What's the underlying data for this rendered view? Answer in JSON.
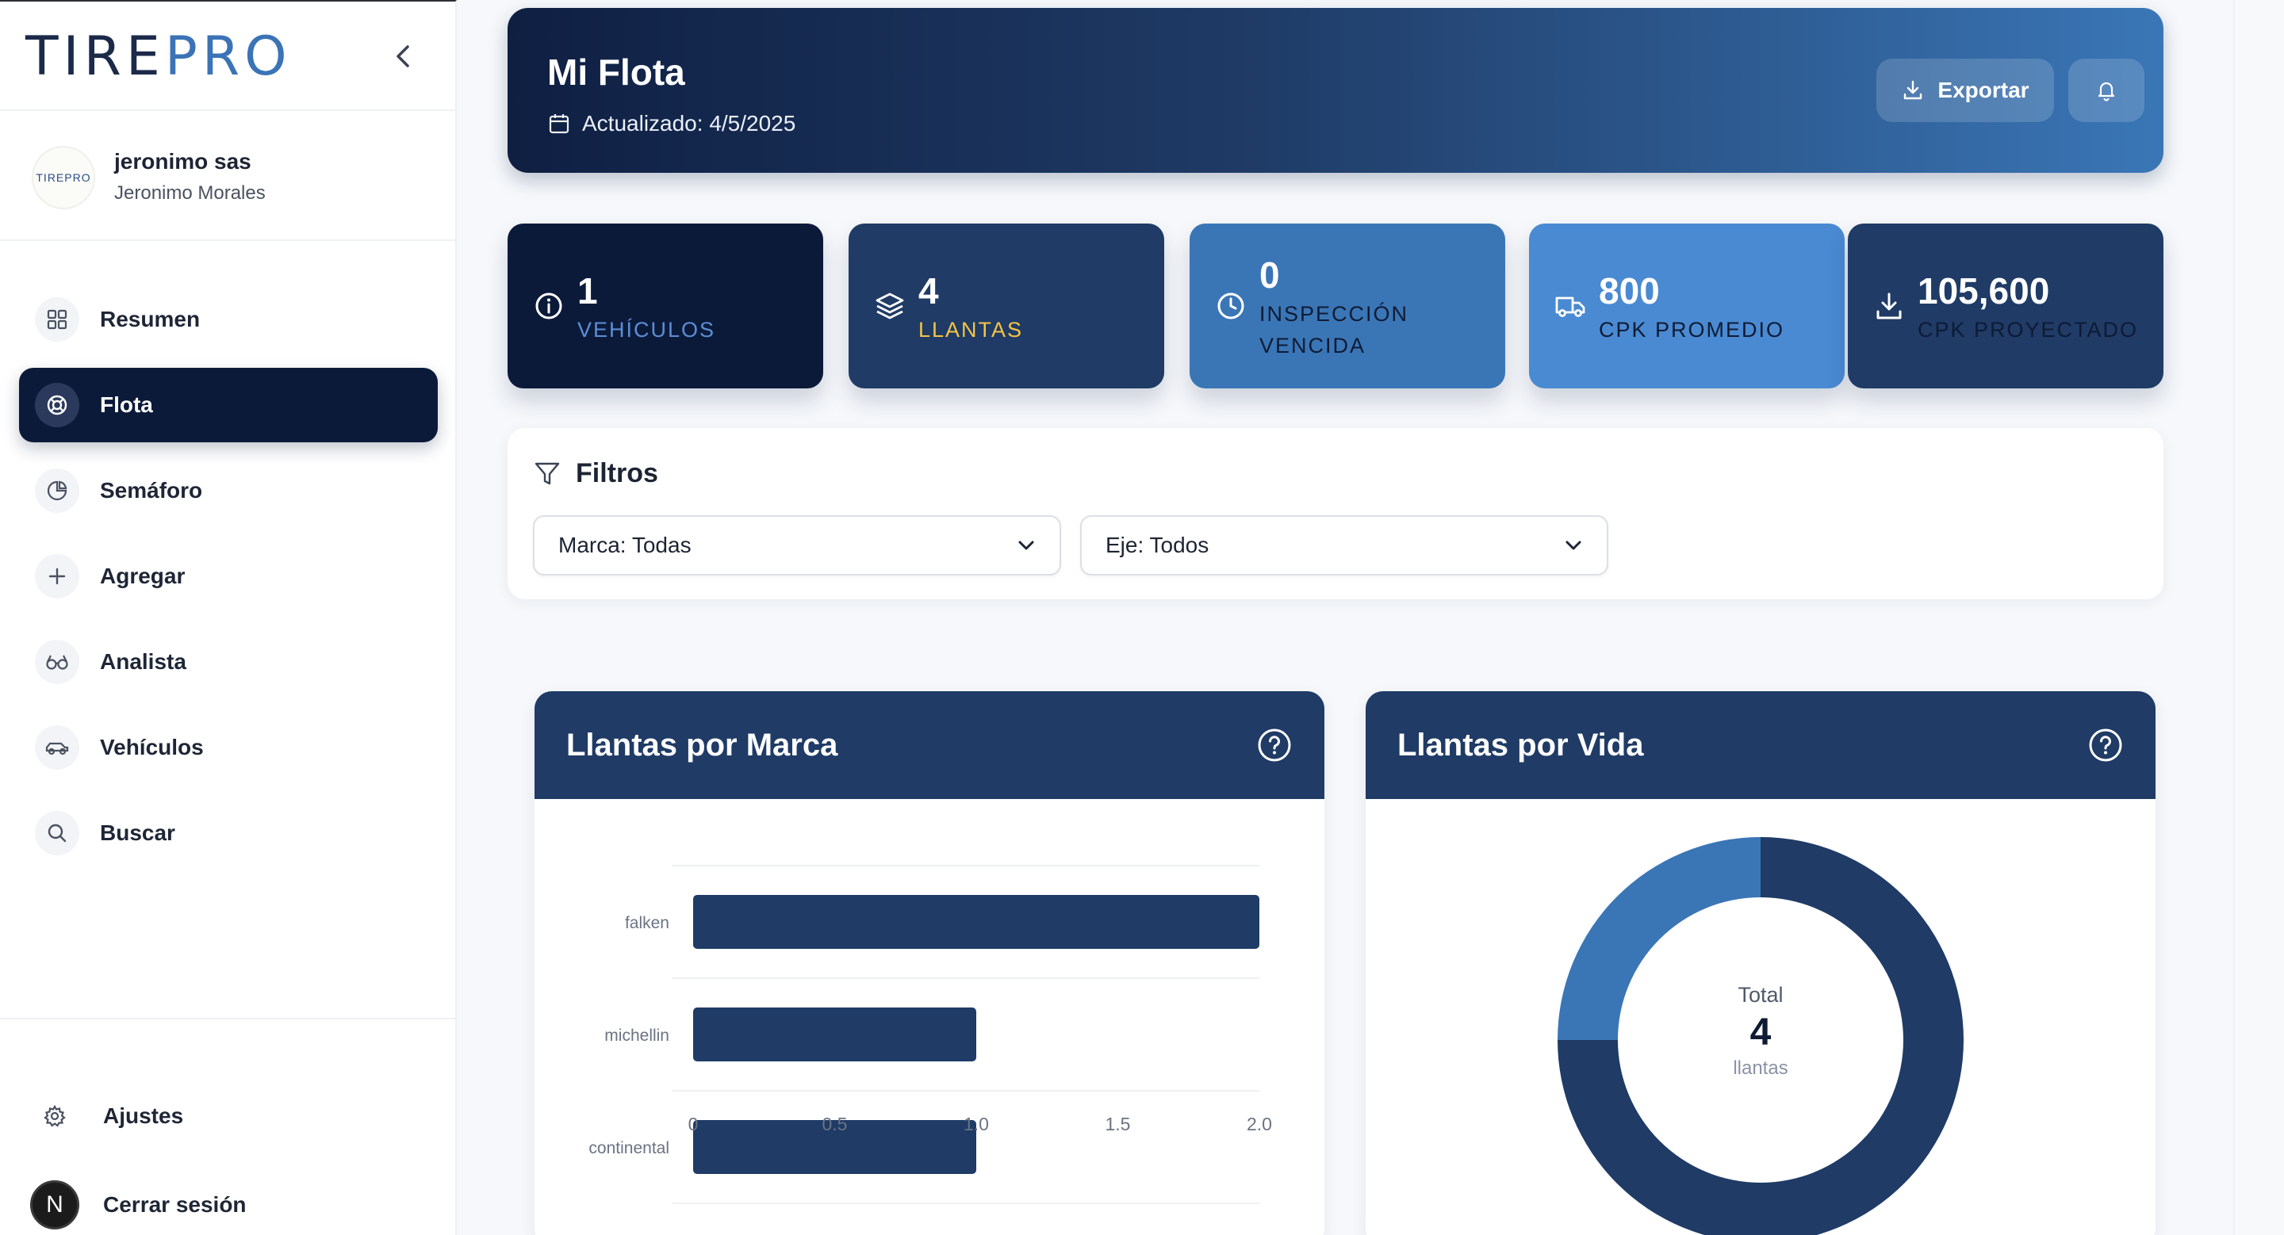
{
  "brand": {
    "logo_part1": "TIRE",
    "logo_part2": "PRO"
  },
  "user": {
    "company": "jeronimo sas",
    "name": "Jeronimo Morales",
    "avatar_text": "TIREPRO"
  },
  "nav": [
    {
      "label": "Resumen",
      "icon": "grid-icon"
    },
    {
      "label": "Flota",
      "icon": "lifebuoy-icon",
      "active": true
    },
    {
      "label": "Semáforo",
      "icon": "pie-icon"
    },
    {
      "label": "Agregar",
      "icon": "plus-icon"
    },
    {
      "label": "Analista",
      "icon": "glasses-icon"
    },
    {
      "label": "Vehículos",
      "icon": "car-icon"
    },
    {
      "label": "Buscar",
      "icon": "search-icon"
    }
  ],
  "bottom": {
    "settings": "Ajustes",
    "logout": "Cerrar sesión",
    "logout_avatar": "N"
  },
  "header": {
    "title": "Mi Flota",
    "updated": "Actualizado: 4/5/2025",
    "export_label": "Exportar"
  },
  "stats": [
    {
      "value": "1",
      "label_lines": [
        "VEHÍCULOS"
      ],
      "bg": "#0c1a3a",
      "label_color": "#5b8fd6",
      "icon": "info-icon"
    },
    {
      "value": "4",
      "label_lines": [
        "LLANTAS"
      ],
      "bg": "#1f3b66",
      "label_color": "#f5c542",
      "icon": "layers-icon"
    },
    {
      "value": "0",
      "label_lines": [
        "INSPECCIÓN",
        "VENCIDA"
      ],
      "bg": "#3a76b6",
      "label_color": "#0f1b34",
      "icon": "clock-icon"
    },
    {
      "value": "800",
      "label_lines": [
        "CPK PROMEDIO"
      ],
      "bg": "#4a8ad2",
      "label_color": "#0f1b34",
      "icon": "truck-icon"
    },
    {
      "value": "105,600",
      "label_lines": [
        "CPK PROYECTADO"
      ],
      "bg": "#1f3b66",
      "label_color": "#0f1b34",
      "icon": "download-icon"
    }
  ],
  "filters": {
    "title": "Filtros",
    "marca": "Marca: Todas",
    "eje": "Eje: Todos"
  },
  "charts": {
    "marca_title": "Llantas por Marca",
    "vida_title": "Llantas por Vida",
    "donut_total_label": "Total",
    "donut_total_value": "4",
    "donut_unit": "llantas"
  },
  "chart_data": [
    {
      "type": "bar",
      "orientation": "horizontal",
      "title": "Llantas por Marca",
      "categories": [
        "falken",
        "michellin",
        "continental"
      ],
      "values": [
        2,
        1,
        1
      ],
      "xlim": [
        0,
        2.0
      ],
      "xticks": [
        "0",
        "0.5",
        "1.0",
        "1.5",
        "2.0"
      ],
      "color": "#1f3b66",
      "grid": true
    },
    {
      "type": "pie",
      "variant": "donut",
      "title": "Llantas por Vida",
      "slices": [
        {
          "value": 3,
          "color": "#1f3b66"
        },
        {
          "value": 1,
          "color": "#3a76b6"
        }
      ],
      "total": 4
    }
  ]
}
